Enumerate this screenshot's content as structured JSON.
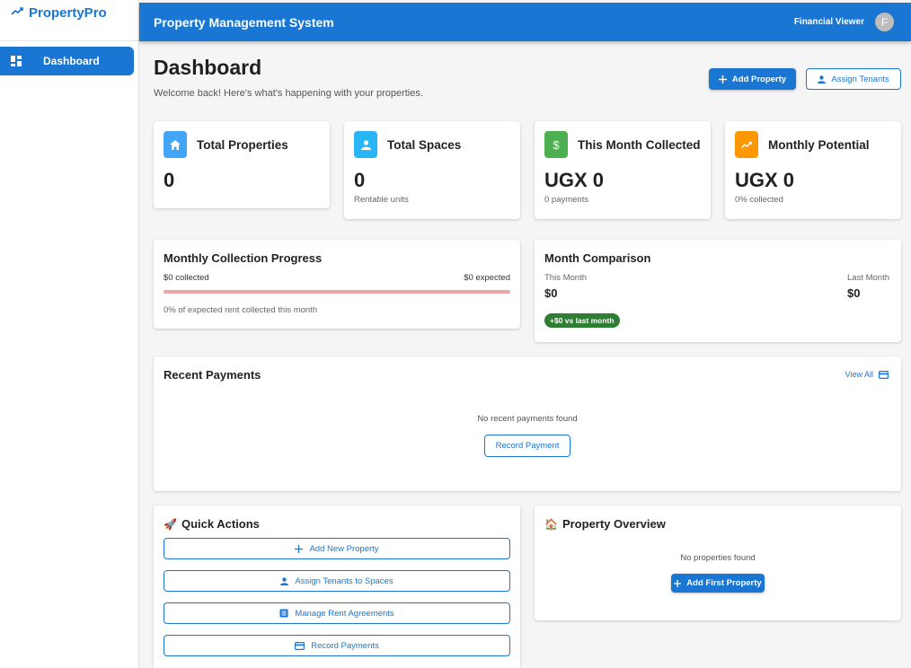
{
  "app": {
    "brand": "PropertyPro",
    "system_title": "Property Management System",
    "user_role": "Financial Viewer",
    "avatar_initial": "F"
  },
  "sidebar": {
    "items": [
      {
        "label": "Dashboard",
        "icon": "dashboard-icon",
        "active": true
      }
    ]
  },
  "header": {
    "title": "Dashboard",
    "subtitle": "Welcome back! Here's what's happening with your properties.",
    "add_property_label": "Add Property",
    "assign_tenants_label": "Assign Tenants"
  },
  "stats": [
    {
      "label": "Total Properties",
      "value": "0",
      "sub": "",
      "icon": "home-icon",
      "color": "#42a5f5"
    },
    {
      "label": "Total Spaces",
      "value": "0",
      "sub": "Rentable units",
      "icon": "person-icon",
      "color": "#29b6f6"
    },
    {
      "label": "This Month Collected",
      "value": "UGX 0",
      "sub": "0 payments",
      "icon": "dollar-icon",
      "color": "#4caf50"
    },
    {
      "label": "Monthly Potential",
      "value": "UGX 0",
      "sub": "0% collected",
      "icon": "trending-up-icon",
      "color": "#ff9800"
    }
  ],
  "collection_progress": {
    "title": "Monthly Collection Progress",
    "collected_text": "$0 collected",
    "expected_text": "$0 expected",
    "progress_fraction": 0,
    "caption": "0% of expected rent collected this month"
  },
  "month_comparison": {
    "title": "Month Comparison",
    "this_month_label": "This Month",
    "this_month_value": "$0",
    "last_month_label": "Last Month",
    "last_month_value": "$0",
    "delta_chip": "+$0 vs last month"
  },
  "recent_payments": {
    "title": "Recent Payments",
    "view_all_label": "View All",
    "empty_text": "No recent payments found",
    "record_payment_label": "Record Payment"
  },
  "quick_actions": {
    "title": "Quick Actions",
    "icon": "rocket-emoji",
    "buttons": [
      {
        "label": "Add New Property",
        "icon": "plus-icon"
      },
      {
        "label": "Assign Tenants to Spaces",
        "icon": "person-icon"
      },
      {
        "label": "Manage Rent Agreements",
        "icon": "list-icon"
      },
      {
        "label": "Record Payments",
        "icon": "credit-card-icon"
      }
    ]
  },
  "property_overview": {
    "title": "Property Overview",
    "icon": "house-emoji",
    "empty_text": "No properties found",
    "add_first_label": "Add First Property"
  },
  "colors": {
    "primary": "#1976d2",
    "success": "#2e7d32",
    "progress_track": "#f0a5a5"
  }
}
